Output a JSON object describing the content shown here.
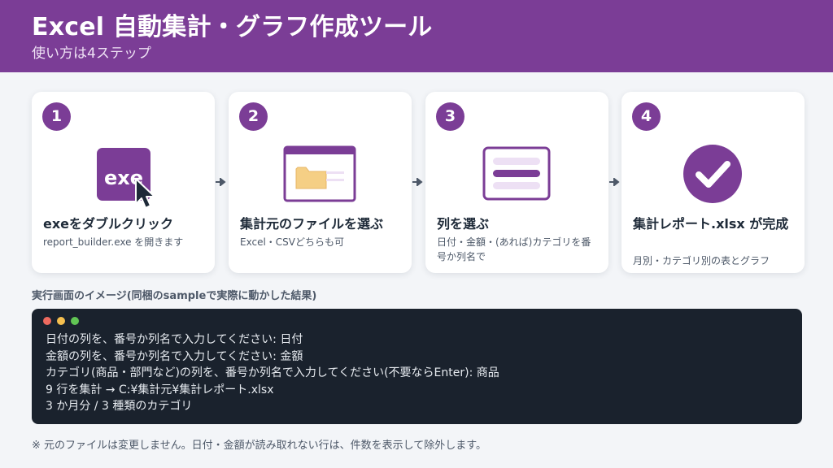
{
  "header": {
    "title": "Excel 自動集計・グラフ作成ツール",
    "subtitle": "使い方は4ステップ"
  },
  "steps": [
    {
      "number": "1",
      "icon": "exe-cursor-icon",
      "icon_text": "exe",
      "title": "exeをダブルクリック",
      "desc": "report_builder.exe を開きます"
    },
    {
      "number": "2",
      "icon": "folder-file-window-icon",
      "title": "集計元のファイルを選ぶ",
      "desc": "Excel・CSVどちらも可"
    },
    {
      "number": "3",
      "icon": "column-list-icon",
      "title": "列を選ぶ",
      "desc": "日付・金額・(あれば)カテゴリを番号か列名で"
    },
    {
      "number": "4",
      "icon": "check-circle-icon",
      "title": "集計レポート.xlsx が完成",
      "desc": "月別・カテゴリ別の表とグラフ"
    }
  ],
  "terminal": {
    "label": "実行画面のイメージ(同梱のsampleで実際に動かした結果)",
    "lines": [
      "日付の列を、番号か列名で入力してください: 日付",
      "金額の列を、番号か列名で入力してください: 金額",
      "カテゴリ(商品・部門など)の列を、番号か列名で入力してください(不要ならEnter): 商品",
      "9 行を集計 → C:¥集計元¥集計レポート.xlsx",
      "3 か月分 / 3 種類のカテゴリ"
    ]
  },
  "footnote": "※ 元のファイルは変更しません。日付・金額が読み取れない行は、件数を表示して除外します。",
  "colors": {
    "brand": "#7b3d96",
    "brand_light": "#ede0f4",
    "folder": "#f5cf85",
    "terminal_bg": "#1a222d",
    "dot_red": "#ee6a5f",
    "dot_yellow": "#f5bf4f",
    "dot_green": "#61c554"
  }
}
